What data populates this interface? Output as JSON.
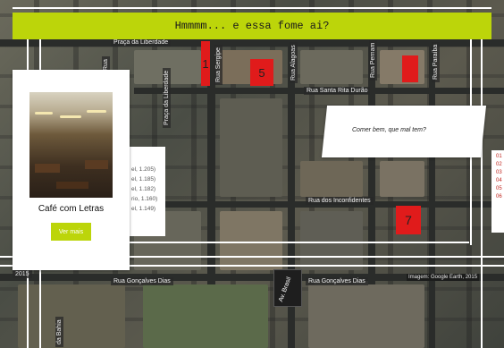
{
  "header": {
    "title": "Hmmmm... e essa fome ai?"
  },
  "map": {
    "streets": {
      "praca_liberdade_top": "Praça da Liberdade",
      "praca_liberdade_vertical": "Praça da Liberdade",
      "rua_sergipe": "Rua Sergipe",
      "rua_alagoas": "Rua Alagoas",
      "rua_pernambuco": "Rua Pernam",
      "rua_paraiba": "Rua Paraíba",
      "rua_santa_rita_durao": "Rua Santa Rita Durão",
      "rua_inconfidentes": "Rua dos Inconfidentes",
      "rua_goncalves_dias_left": "Rua Gonçalves Dias",
      "rua_goncalves_dias_right": "Rua Gonçalves Dias",
      "av_brasil": "Av. Brasil",
      "rua_bahia": "da Bahia",
      "left_vertical": "Rua",
      "left_number": "2015"
    },
    "markers": [
      {
        "number": "1"
      },
      {
        "number": "5"
      },
      {
        "number": "7"
      }
    ],
    "credit": "Imagem: Google Earth, 2015"
  },
  "card": {
    "title": "Café com Letras",
    "button_label": "Ver mais"
  },
  "legend_fragment": [
    "el, 1.205)",
    "el, 1.185)",
    "el, 1.182)",
    "rio, 1.160)",
    "el, 1.149)"
  ],
  "speech": {
    "text": "Comer bem, que mal tem?"
  },
  "right_legend": [
    "01",
    "02",
    "03",
    "04",
    "05",
    "06"
  ],
  "colors": {
    "accent": "#bcd50a",
    "marker": "#e01b1b"
  }
}
